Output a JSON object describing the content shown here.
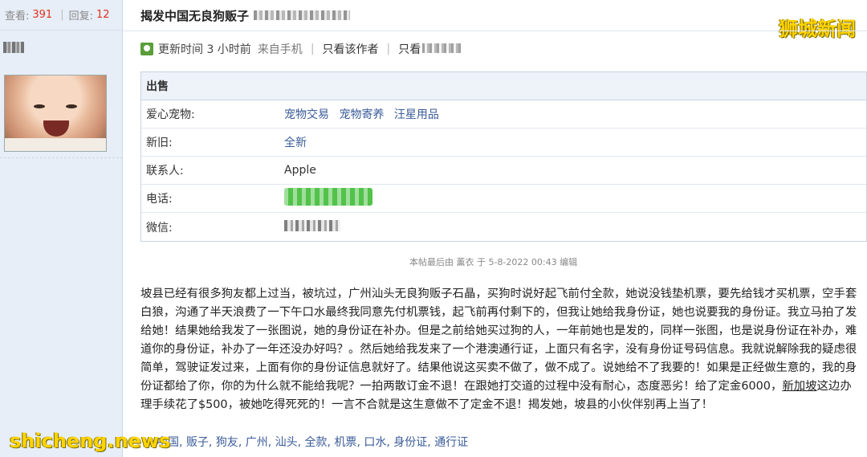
{
  "sidebar": {
    "views_label": "查看:",
    "views_count": "391",
    "replies_label": "回复:",
    "replies_count": "12"
  },
  "post": {
    "title": "揭发中国无良狗贩子",
    "meta": {
      "updated": "更新时间 3 小时前",
      "source": "来自手机",
      "only_author": "只看该作者",
      "only_prefix": "只看"
    },
    "sale": {
      "header": "出售",
      "rows": [
        {
          "label": "爱心宠物:",
          "links": [
            "宠物交易",
            "宠物寄养",
            "汪星用品"
          ]
        },
        {
          "label": "新旧:",
          "value": "全新"
        },
        {
          "label": "联系人:",
          "value": "Apple"
        },
        {
          "label": "电话:"
        },
        {
          "label": "微信:"
        }
      ]
    },
    "edit_note": "本帖最后由 薰衣 于 5-8-2022 00:43 编辑",
    "content": {
      "p1": "坡县已经有很多狗友都上过当，被坑过，广州汕头无良狗贩子石晶，买狗时说好起飞前付全款，她说没钱垫机票，要先给钱才买机票，空手套白狼，沟通了半天浪费了一下午口水最终我同意先付机票钱，起飞前再付剩下的，但我让她给我身份证，她也说要我的身份证。我立马拍了发给她！结果她给我发了一张图说，她的身份证在补办。但是之前给她买过狗的人，一年前她也是发的，同样一张图，也是说身份证在补办，难道你的身份证，补办了一年还没办好吗？。然后她给我发来了一个港澳通行证，上面只有名字，没有身份证号码信息。我就说解除我的疑虑很简单，驾驶证发过来，上面有你的身份证信息就好了。结果他说这买卖不做了，做不成了。说她给不了我要的！如果是正经做生意的，我的身份证都给了你，你的为什么就不能给我呢？一拍两散订金不退！在跟她打交道的过程中没有耐心，态度恶劣！给了定金6000，",
      "link": "新加坡",
      "p2": "这边办理手续花了$500，被她吃得死死的！一言不合就是这生意做不了定金不退！揭发她，坡县的小伙伴别再上当了！"
    },
    "tags": [
      "中国",
      "贩子",
      "狗友",
      "广州",
      "汕头",
      "全款",
      "机票",
      "口水",
      "身份证",
      "通行证"
    ]
  },
  "watermark_top": "狮城新闻",
  "watermark_bottom": "shicheng.news"
}
